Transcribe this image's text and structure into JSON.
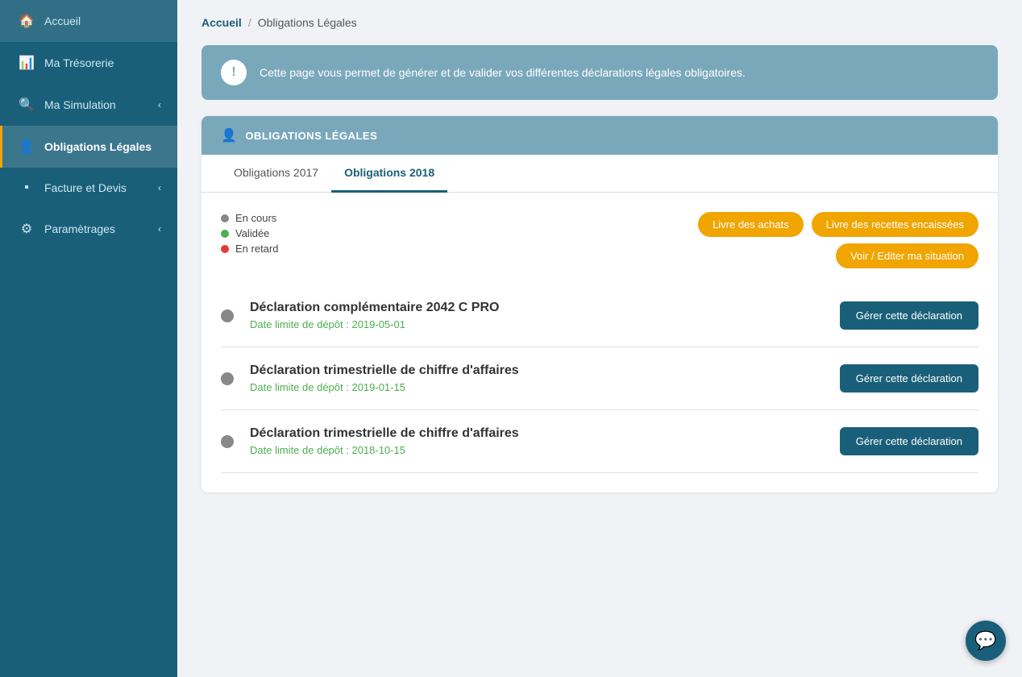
{
  "sidebar": {
    "items": [
      {
        "id": "accueil",
        "label": "Accueil",
        "icon": "🏠",
        "active": false
      },
      {
        "id": "tresorerie",
        "label": "Ma Trésorerie",
        "icon": "📊",
        "active": false
      },
      {
        "id": "simulation",
        "label": "Ma Simulation",
        "icon": "🔍",
        "active": false,
        "hasChevron": true
      },
      {
        "id": "obligations",
        "label": "Obligations Légales",
        "icon": "👤",
        "active": true
      },
      {
        "id": "facture",
        "label": "Facture et Devis",
        "icon": "▪",
        "active": false,
        "hasChevron": true
      },
      {
        "id": "parametrages",
        "label": "Paramètrages",
        "icon": "⚙",
        "active": false,
        "hasChevron": true
      }
    ]
  },
  "breadcrumb": {
    "home": "Accueil",
    "separator": "/",
    "current": "Obligations Légales"
  },
  "infoBanner": {
    "text": "Cette page vous permet de générer et de valider vos différentes déclarations légales obligatoires."
  },
  "obligationsCard": {
    "headerIcon": "👤",
    "headerLabel": "OBLIGATIONS LÉGALES",
    "tabs": [
      {
        "id": "2017",
        "label": "Obligations 2017",
        "active": false
      },
      {
        "id": "2018",
        "label": "Obligations 2018",
        "active": true
      }
    ],
    "legend": [
      {
        "id": "en-cours",
        "label": "En cours",
        "color": "gray"
      },
      {
        "id": "validee",
        "label": "Validée",
        "color": "green"
      },
      {
        "id": "en-retard",
        "label": "En retard",
        "color": "red"
      }
    ],
    "actionButtons": [
      {
        "id": "livre-achats",
        "label": "Livre des achats"
      },
      {
        "id": "livre-recettes",
        "label": "Livre des recettes encaissées"
      },
      {
        "id": "voir-editer",
        "label": "Voir / Editer ma situation"
      }
    ],
    "declarations": [
      {
        "id": "decl-1",
        "title": "Déclaration complémentaire 2042 C PRO",
        "date": "Date limite de dépôt : 2019-05-01",
        "buttonLabel": "Gérer cette déclaration",
        "statusColor": "gray"
      },
      {
        "id": "decl-2",
        "title": "Déclaration trimestrielle de chiffre d'affaires",
        "date": "Date limite de dépôt : 2019-01-15",
        "buttonLabel": "Gérer cette déclaration",
        "statusColor": "gray"
      },
      {
        "id": "decl-3",
        "title": "Déclaration trimestrielle de chiffre d'affaires",
        "date": "Date limite de dépôt : 2018-10-15",
        "buttonLabel": "Gérer cette déclaration",
        "statusColor": "gray"
      }
    ]
  }
}
